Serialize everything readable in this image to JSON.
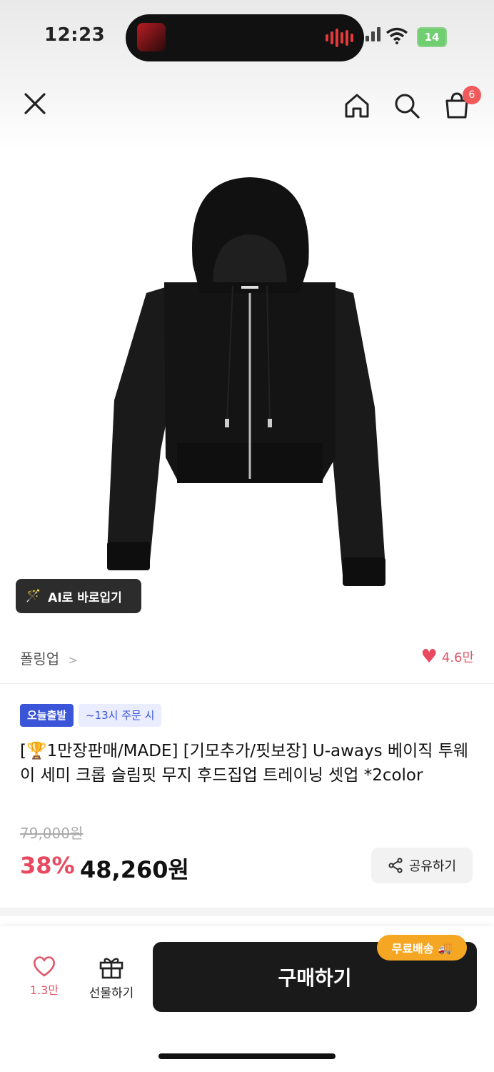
{
  "status_bar": {
    "time": "12:23",
    "battery": "14"
  },
  "header": {
    "cart_count": "6"
  },
  "product": {
    "ai_fit_label": "AI로 바로입기",
    "brand": "폴링업",
    "brand_chevron": ">",
    "like_count": "4.6만",
    "badge_today": "오늘출발",
    "badge_cutoff": "~13시 주문 시",
    "title": "[🏆1만장판매/MADE] [기모추가/핏보장] U-aways 베이직 투웨이 세미 크롭 슬림핏 무지 후드집업 트레이닝 셋업 *2color",
    "original_price": "79,000원",
    "discount": "38%",
    "price": "48,260원",
    "share_label": "공유하기"
  },
  "bottom_bar": {
    "wish_count": "1.3만",
    "gift_label": "선물하기",
    "buy_label": "구매하기",
    "free_shipping": "무료배송"
  },
  "colors": {
    "accent_red": "#e8495f",
    "buy_button": "#1a1a1a",
    "today_badge": "#3b55d9",
    "free_ship": "#f5a623"
  }
}
